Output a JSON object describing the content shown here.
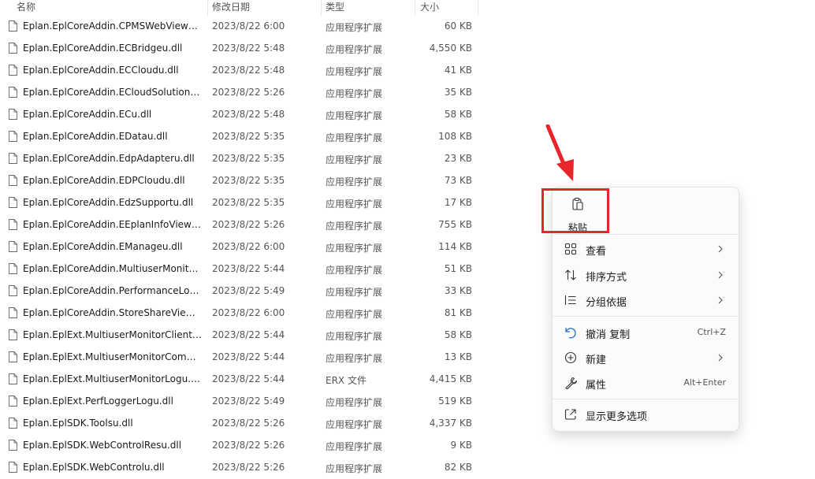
{
  "columns": {
    "name": "名称",
    "date": "修改日期",
    "type": "类型",
    "size": "大小"
  },
  "files": [
    {
      "name": "Eplan.EplCoreAddin.CPMSWebViewu...",
      "date": "2023/8/22 6:00",
      "type": "应用程序扩展",
      "size": "60 KB"
    },
    {
      "name": "Eplan.EplCoreAddin.ECBridgeu.dll",
      "date": "2023/8/22 5:48",
      "type": "应用程序扩展",
      "size": "4,550 KB"
    },
    {
      "name": "Eplan.EplCoreAddin.ECCloudu.dll",
      "date": "2023/8/22 5:48",
      "type": "应用程序扩展",
      "size": "41 KB"
    },
    {
      "name": "Eplan.EplCoreAddin.ECloudSolutions...",
      "date": "2023/8/22 5:26",
      "type": "应用程序扩展",
      "size": "35 KB"
    },
    {
      "name": "Eplan.EplCoreAddin.ECu.dll",
      "date": "2023/8/22 5:48",
      "type": "应用程序扩展",
      "size": "58 KB"
    },
    {
      "name": "Eplan.EplCoreAddin.EDatau.dll",
      "date": "2023/8/22 5:35",
      "type": "应用程序扩展",
      "size": "108 KB"
    },
    {
      "name": "Eplan.EplCoreAddin.EdpAdapteru.dll",
      "date": "2023/8/22 5:35",
      "type": "应用程序扩展",
      "size": "23 KB"
    },
    {
      "name": "Eplan.EplCoreAddin.EDPCloudu.dll",
      "date": "2023/8/22 5:35",
      "type": "应用程序扩展",
      "size": "73 KB"
    },
    {
      "name": "Eplan.EplCoreAddin.EdzSupportu.dll",
      "date": "2023/8/22 5:35",
      "type": "应用程序扩展",
      "size": "17 KB"
    },
    {
      "name": "Eplan.EplCoreAddin.EEplanInfoViewu...",
      "date": "2023/8/22 5:26",
      "type": "应用程序扩展",
      "size": "755 KB"
    },
    {
      "name": "Eplan.EplCoreAddin.EManageu.dll",
      "date": "2023/8/22 6:00",
      "type": "应用程序扩展",
      "size": "114 KB"
    },
    {
      "name": "Eplan.EplCoreAddin.MultiuserMonito...",
      "date": "2023/8/22 5:44",
      "type": "应用程序扩展",
      "size": "51 KB"
    },
    {
      "name": "Eplan.EplCoreAddin.PerformanceLog...",
      "date": "2023/8/22 5:49",
      "type": "应用程序扩展",
      "size": "33 KB"
    },
    {
      "name": "Eplan.EplCoreAddin.StoreShareViewu...",
      "date": "2023/8/22 6:00",
      "type": "应用程序扩展",
      "size": "81 KB"
    },
    {
      "name": "Eplan.EplExt.MultiuserMonitorClientu...",
      "date": "2023/8/22 5:44",
      "type": "应用程序扩展",
      "size": "58 KB"
    },
    {
      "name": "Eplan.EplExt.MultiuserMonitorComm...",
      "date": "2023/8/22 5:44",
      "type": "应用程序扩展",
      "size": "13 KB"
    },
    {
      "name": "Eplan.EplExt.MultiuserMonitorLogu.erx",
      "date": "2023/8/22 5:44",
      "type": "ERX 文件",
      "size": "4,415 KB"
    },
    {
      "name": "Eplan.EplExt.PerfLoggerLogu.dll",
      "date": "2023/8/22 5:49",
      "type": "应用程序扩展",
      "size": "519 KB"
    },
    {
      "name": "Eplan.EplSDK.Toolsu.dll",
      "date": "2023/8/22 5:26",
      "type": "应用程序扩展",
      "size": "4,337 KB"
    },
    {
      "name": "Eplan.EplSDK.WebControlResu.dll",
      "date": "2023/8/22 5:26",
      "type": "应用程序扩展",
      "size": "9 KB"
    },
    {
      "name": "Eplan.EplSDK.WebControlu.dll",
      "date": "2023/8/22 5:26",
      "type": "应用程序扩展",
      "size": "82 KB"
    }
  ],
  "menu": {
    "paste": "粘贴",
    "items": [
      {
        "label": "查看",
        "icon": "grid-view-icon",
        "submenu": true
      },
      {
        "label": "排序方式",
        "icon": "sort-icon",
        "submenu": true
      },
      {
        "label": "分组依据",
        "icon": "group-list-icon",
        "submenu": true
      },
      {
        "label": "撤消 复制",
        "icon": "undo-icon",
        "shortcut": "Ctrl+Z"
      },
      {
        "label": "新建",
        "icon": "new-plus-icon",
        "submenu": true
      },
      {
        "label": "属性",
        "icon": "wrench-icon",
        "shortcut": "Alt+Enter"
      },
      {
        "label": "显示更多选项",
        "icon": "show-more-icon"
      }
    ]
  },
  "colors": {
    "annotation_red": "#e8262a",
    "menu_bg": "#fbfbfb"
  }
}
